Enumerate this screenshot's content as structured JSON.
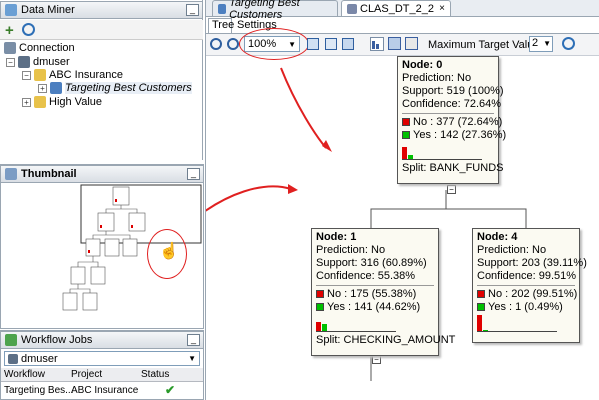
{
  "data_miner": {
    "title": "Data Miner",
    "tree": {
      "connection": "Connection",
      "user": "dmuser",
      "project": "ABC Insurance",
      "workflow": "Targeting Best Customers",
      "other_project": "High Value"
    }
  },
  "thumbnail": {
    "title": "Thumbnail"
  },
  "workflow_jobs": {
    "title": "Workflow Jobs",
    "connection_selected": "dmuser",
    "columns": [
      "Workflow",
      "Project",
      "Status"
    ],
    "rows": [
      {
        "workflow": "Targeting Bes...",
        "project": "ABC Insurance",
        "status": "check-icon"
      }
    ]
  },
  "editor": {
    "tabs": [
      "Targeting Best Customers",
      "CLAS_DT_2_2"
    ],
    "subtabs": [
      "Tree",
      "Settings"
    ],
    "zoom": "100%",
    "max_target_label": "Maximum Target Values:",
    "max_target_value": "2"
  },
  "nodes": [
    {
      "id": "Node: 0",
      "prediction": "Prediction: No",
      "support": "Support: 519 (100%)",
      "confidence": "Confidence: 72.64%",
      "no": "No : 377  (72.64%)",
      "yes": "Yes : 142  (27.36%)",
      "split": "Split: BANK_FUNDS",
      "no_fraction": 0.7264,
      "yes_fraction": 0.2736
    },
    {
      "id": "Node: 1",
      "prediction": "Prediction: No",
      "support": "Support: 316 (60.89%)",
      "confidence": "Confidence: 55.38%",
      "no": "No : 175  (55.38%)",
      "yes": "Yes : 141  (44.62%)",
      "split": "Split: CHECKING_AMOUNT",
      "no_fraction": 0.5538,
      "yes_fraction": 0.4462
    },
    {
      "id": "Node: 4",
      "prediction": "Prediction: No",
      "support": "Support: 203 (39.11%)",
      "confidence": "Confidence: 99.51%",
      "no": "No : 202  (99.51%)",
      "yes": "Yes : 1  (0.49%)",
      "split": "",
      "no_fraction": 0.9951,
      "yes_fraction": 0.0049
    }
  ],
  "colors": {
    "no": "#e00000",
    "yes": "#00c000",
    "annotation": "#e02020",
    "panel_header": "#dfe4ea"
  }
}
